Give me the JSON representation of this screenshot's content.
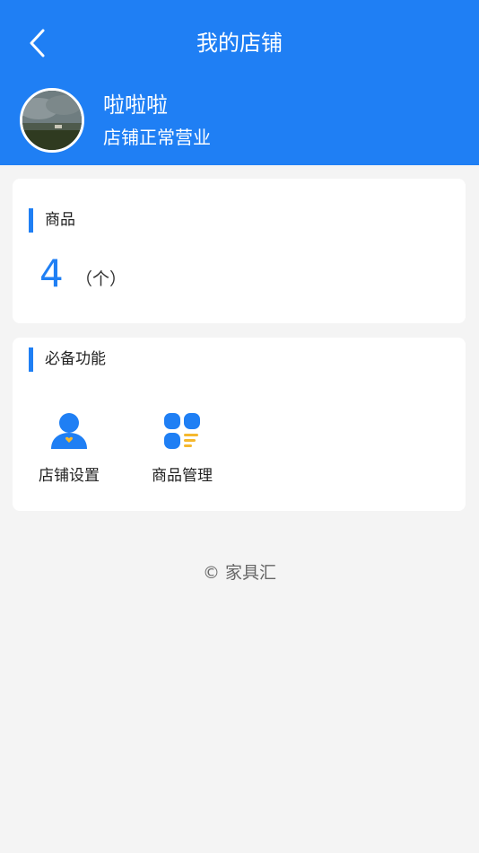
{
  "header": {
    "title": "我的店铺",
    "back_icon": "chevron-left-icon",
    "background_color": "#1f7ff4"
  },
  "store": {
    "name": "啦啦啦",
    "status": "店铺正常营业"
  },
  "goods_section": {
    "title": "商品",
    "count": "4",
    "unit": "（个）"
  },
  "features_section": {
    "title": "必备功能",
    "items": [
      {
        "label": "店铺设置",
        "icon": "user-settings-icon"
      },
      {
        "label": "商品管理",
        "icon": "grid-list-icon"
      }
    ]
  },
  "footer": {
    "text": "© 家具汇"
  },
  "colors": {
    "accent": "#1f7ff4",
    "highlight": "#f5b82e",
    "page_background": "#f4f4f4"
  }
}
